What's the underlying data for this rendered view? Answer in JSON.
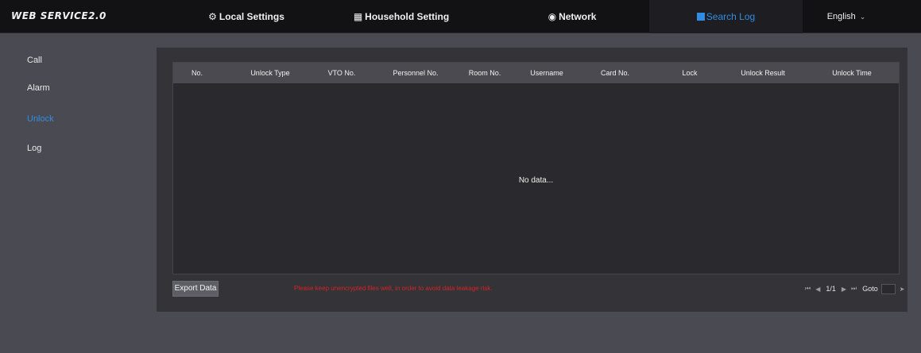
{
  "app": {
    "logo": "WEB SERVICE2.0"
  },
  "nav": {
    "local_settings": {
      "icon": "gear-icon",
      "label": "Local Settings"
    },
    "household_setting": {
      "icon": "building-icon",
      "label": "Household Setting"
    },
    "network": {
      "icon": "globe-icon",
      "label": "Network"
    },
    "search_log": {
      "icon": "square-icon",
      "label": "Search Log",
      "active": true
    },
    "language": {
      "label": "English"
    }
  },
  "sidebar": {
    "items": [
      {
        "label": "Call"
      },
      {
        "label": "Alarm"
      },
      {
        "label": "Unlock",
        "active": true
      },
      {
        "label": "Log"
      }
    ]
  },
  "table": {
    "columns": [
      "No.",
      "Unlock Type",
      "VTO No.",
      "Personnel No.",
      "Room No.",
      "Username",
      "Card No.",
      "Lock",
      "Unlock Result",
      "Unlock Time"
    ],
    "rows": [],
    "empty_text": "No data..."
  },
  "footer": {
    "export_label": "Export Data",
    "warning": "Please keep unencrypted files well, in order to avoid data leakage risk.",
    "pager": {
      "page": "1/1",
      "goto_label": "Goto",
      "goto_value": ""
    }
  },
  "colors": {
    "accent": "#2f8de4",
    "warning": "#d42424",
    "topbar": "#121215"
  }
}
